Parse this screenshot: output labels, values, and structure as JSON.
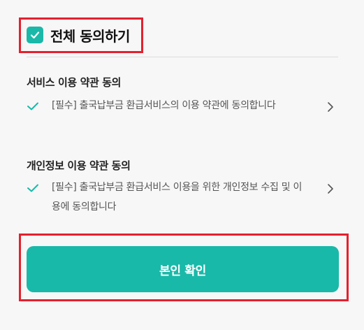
{
  "all_agree": {
    "label": "전체 동의하기",
    "checked": true
  },
  "sections": [
    {
      "title": "서비스 이용 약관 동의",
      "term": "[필수] 출국납부금 환급서비스의 이용 약관에 동의합니다",
      "checked": true
    },
    {
      "title": "개인정보 이용 약관 동의",
      "term": "[필수] 출국납부금 환급서비스 이용을 위한 개인정보 수집 및 이용에 동의합니다",
      "checked": true
    }
  ],
  "confirm_button": {
    "label": "본인 확인"
  },
  "colors": {
    "accent": "#19b9a9",
    "highlight": "#e5202e"
  },
  "icons": {
    "checkbox": "checkbox-checked-icon",
    "check": "check-icon",
    "chevron": "chevron-right-icon"
  }
}
